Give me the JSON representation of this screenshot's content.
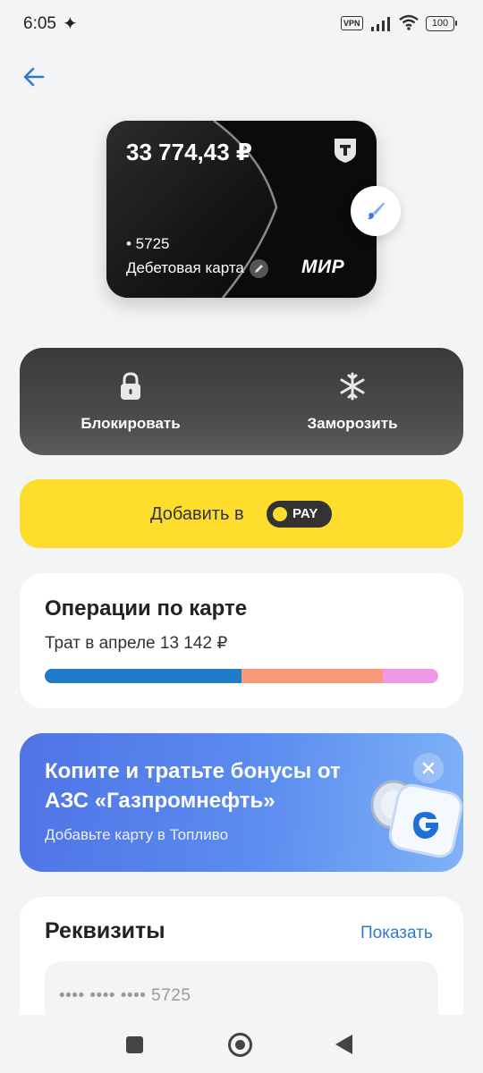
{
  "status_bar": {
    "time": "6:05",
    "vpn_label": "VPN",
    "battery_level": "100",
    "icons": [
      "sparkle-icon",
      "signal-icon",
      "wifi-icon",
      "battery-icon"
    ]
  },
  "header": {
    "back_icon": "arrow-left-icon"
  },
  "card": {
    "balance": "33 774,43 ₽",
    "number": "• 5725",
    "type": "Дебетовая карта",
    "bank_logo": "t-bank-shield-icon",
    "payment_system": "МИР",
    "edit_icon": "pencil-icon",
    "design_icon": "paint-brush-icon"
  },
  "actions": {
    "block_label": "Блокировать",
    "block_icon": "lock-icon",
    "freeze_label": "Заморозить",
    "freeze_icon": "snowflake-icon"
  },
  "pay": {
    "label": "Добавить в",
    "badge_text": "PAY"
  },
  "operations": {
    "title": "Операции по карте",
    "subtitle": "Трат в апреле 13 142 ₽",
    "segments": [
      {
        "share": 0.5,
        "color": "#1f7ac8"
      },
      {
        "share": 0.36,
        "color": "#f79a7a"
      },
      {
        "share": 0.14,
        "color": "#ee9ae6"
      }
    ]
  },
  "promo": {
    "title": "Копите и тратьте бонусы от АЗС «Газпромнефть»",
    "subtitle": "Добавьте карту в Топливо",
    "close_icon": "close-icon"
  },
  "requisites": {
    "title": "Реквизиты",
    "show_label": "Показать",
    "card_number_masked": "•••• •••• •••• 5725"
  },
  "nav": {
    "icons": [
      "recents-icon",
      "home-icon",
      "back-triangle-icon"
    ]
  },
  "colors": {
    "accent_yellow": "#ffdd2d",
    "link_blue": "#3377cc",
    "card_black": "#0b0b0b"
  }
}
